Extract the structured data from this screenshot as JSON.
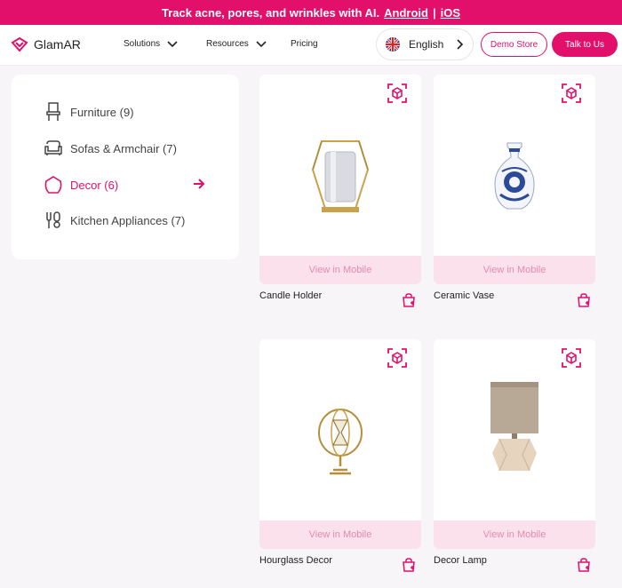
{
  "promo": {
    "text": "Track acne, pores, and wrinkles with AI.",
    "android": "Android",
    "separator": "|",
    "ios": "iOS"
  },
  "nav": {
    "brand": "GlamAR",
    "menu": [
      "Solutions",
      "Resources",
      "Pricing"
    ],
    "language": "English",
    "demo_store": "Demo Store",
    "talk": "Talk to Us"
  },
  "categories": [
    {
      "label": "Furniture (9)",
      "icon": "chair-icon"
    },
    {
      "label": "Sofas & Armchair (7)",
      "icon": "sofa-icon"
    },
    {
      "label": "Decor (6)",
      "icon": "decor-icon",
      "active": true
    },
    {
      "label": "Kitchen Appliances (7)",
      "icon": "utensils-icon"
    }
  ],
  "products": [
    {
      "name": "Candle Holder",
      "button": "View in Mobile",
      "image": "candle-holder"
    },
    {
      "name": "Ceramic Vase",
      "button": "View in Mobile",
      "image": "ceramic-vase"
    },
    {
      "name": "Hourglass Decor",
      "button": "View in Mobile",
      "image": "hourglass-decor"
    },
    {
      "name": "Decor Lamp",
      "button": "View in Mobile",
      "image": "decor-lamp"
    }
  ],
  "colors": {
    "accent": "#e2106a",
    "button_bg": "#fbe1ec",
    "button_text": "#e58aaf",
    "page_bg": "#f8f5f8"
  }
}
